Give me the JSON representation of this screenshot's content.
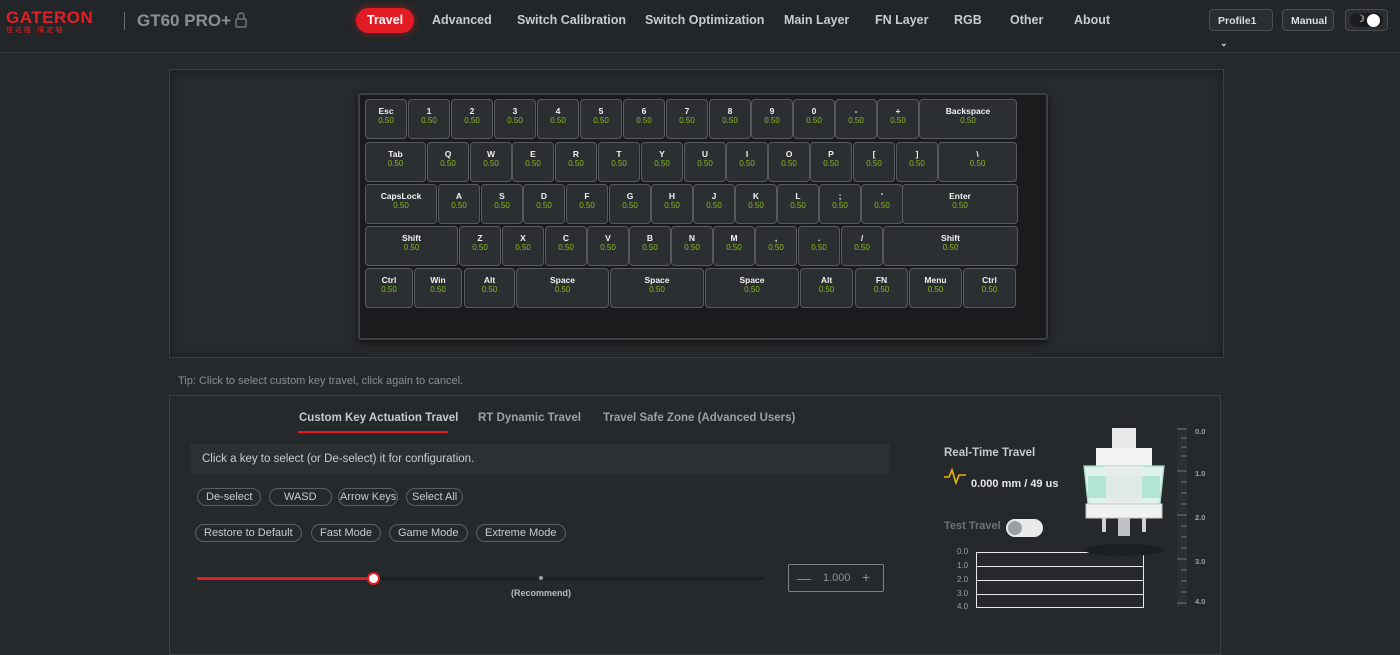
{
  "brand": {
    "name": "GATERON",
    "subtitle": "佳达隆·懂定轴"
  },
  "model": "GT60 PRO+",
  "nav": [
    {
      "label": "Travel",
      "active": true
    },
    {
      "label": "Advanced"
    },
    {
      "label": "Switch Calibration"
    },
    {
      "label": "Switch Optimization"
    },
    {
      "label": "Main Layer"
    },
    {
      "label": "FN Layer"
    },
    {
      "label": "RGB"
    },
    {
      "label": "Other"
    },
    {
      "label": "About"
    }
  ],
  "profile": {
    "label": "Profile1",
    "mode": "Manual"
  },
  "theme": {
    "mode": "dark"
  },
  "keyboard": {
    "rows": [
      [
        {
          "label": "Esc",
          "value": "0.50"
        },
        {
          "label": "1",
          "value": "0.50"
        },
        {
          "label": "2",
          "value": "0.50"
        },
        {
          "label": "3",
          "value": "0.50"
        },
        {
          "label": "4",
          "value": "0.50"
        },
        {
          "label": "5",
          "value": "0.50"
        },
        {
          "label": "6",
          "value": "0.50"
        },
        {
          "label": "7",
          "value": "0.50"
        },
        {
          "label": "8",
          "value": "0.50"
        },
        {
          "label": "9",
          "value": "0.50"
        },
        {
          "label": "0",
          "value": "0.50"
        },
        {
          "label": "-",
          "value": "0.50"
        },
        {
          "label": "+",
          "value": "0.50"
        },
        {
          "label": "Backspace",
          "value": "0.50"
        }
      ],
      [
        {
          "label": "Tab",
          "value": "0.50"
        },
        {
          "label": "Q",
          "value": "0.50"
        },
        {
          "label": "W",
          "value": "0.50"
        },
        {
          "label": "E",
          "value": "0.50"
        },
        {
          "label": "R",
          "value": "0.50"
        },
        {
          "label": "T",
          "value": "0.50"
        },
        {
          "label": "Y",
          "value": "0.50"
        },
        {
          "label": "U",
          "value": "0.50"
        },
        {
          "label": "I",
          "value": "0.50"
        },
        {
          "label": "O",
          "value": "0.50"
        },
        {
          "label": "P",
          "value": "0.50"
        },
        {
          "label": "[",
          "value": "0.50"
        },
        {
          "label": "]",
          "value": "0.50"
        },
        {
          "label": "\\",
          "value": "0.50"
        }
      ],
      [
        {
          "label": "CapsLock",
          "value": "0.50"
        },
        {
          "label": "A",
          "value": "0.50"
        },
        {
          "label": "S",
          "value": "0.50"
        },
        {
          "label": "D",
          "value": "0.50"
        },
        {
          "label": "F",
          "value": "0.50"
        },
        {
          "label": "G",
          "value": "0.50"
        },
        {
          "label": "H",
          "value": "0.50"
        },
        {
          "label": "J",
          "value": "0.50"
        },
        {
          "label": "K",
          "value": "0.50"
        },
        {
          "label": "L",
          "value": "0.50"
        },
        {
          "label": ";",
          "value": "0.50"
        },
        {
          "label": "'",
          "value": "0.50"
        },
        {
          "label": "Enter",
          "value": "0.50"
        }
      ],
      [
        {
          "label": "Shift",
          "value": "0.50"
        },
        {
          "label": "Z",
          "value": "0.50"
        },
        {
          "label": "X",
          "value": "0.50"
        },
        {
          "label": "C",
          "value": "0.50"
        },
        {
          "label": "V",
          "value": "0.50"
        },
        {
          "label": "B",
          "value": "0.50"
        },
        {
          "label": "N",
          "value": "0.50"
        },
        {
          "label": "M",
          "value": "0.50"
        },
        {
          "label": ",",
          "value": "0.50"
        },
        {
          "label": ".",
          "value": "0.50"
        },
        {
          "label": "/",
          "value": "0.50"
        },
        {
          "label": "Shift",
          "value": "0.50"
        }
      ],
      [
        {
          "label": "Ctrl",
          "value": "0.50"
        },
        {
          "label": "Win",
          "value": "0.50"
        },
        {
          "label": "Alt",
          "value": "0.50"
        },
        {
          "label": "Space",
          "value": "0.50"
        },
        {
          "label": "Space",
          "value": "0.50"
        },
        {
          "label": "Space",
          "value": "0.50"
        },
        {
          "label": "Alt",
          "value": "0.50"
        },
        {
          "label": "FN",
          "value": "0.50"
        },
        {
          "label": "Menu",
          "value": "0.50"
        },
        {
          "label": "Ctrl",
          "value": "0.50"
        }
      ]
    ]
  },
  "tip": "Tip: Click to select custom key travel, click again to cancel.",
  "tabs": [
    {
      "label": "Custom Key Actuation Travel",
      "active": true
    },
    {
      "label": "RT Dynamic Travel"
    },
    {
      "label": "Travel Safe Zone (Advanced Users)"
    }
  ],
  "hint": "Click a key to select (or De-select) it for configuration.",
  "select_buttons": [
    "De-select",
    "WASD",
    "Arrow Keys",
    "Select All"
  ],
  "mode_buttons": [
    "Restore to Default",
    "Fast Mode",
    "Game Mode",
    "Extreme Mode"
  ],
  "slider": {
    "fraction": 0.31,
    "recommend_label": "(Recommend)"
  },
  "stepper": {
    "minus": "—",
    "value": "1.000",
    "plus": "+"
  },
  "realtime": {
    "title": "Real-Time Travel",
    "value": "0.000 mm / 49 us"
  },
  "test_travel": {
    "label": "Test Travel",
    "enabled": false
  },
  "graph_axis": [
    "0.0",
    "1.0",
    "2.0",
    "3.0",
    "4.0"
  ],
  "ruler_labels": [
    "0.0",
    "1.0",
    "2.0",
    "3.0",
    "4.0"
  ],
  "colors": {
    "accent": "#e31b23",
    "value_green": "#84b91f",
    "background": "#25292b"
  }
}
